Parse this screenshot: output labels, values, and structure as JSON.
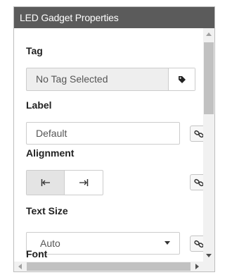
{
  "panel": {
    "title": "LED Gadget Properties"
  },
  "tag": {
    "label": "Tag",
    "value": "No Tag Selected",
    "button_icon": "tag-icon"
  },
  "label_field": {
    "label": "Label",
    "value": "Default",
    "link_icon": "link-icon"
  },
  "alignment": {
    "label": "Alignment",
    "options": [
      {
        "icon": "align-left-icon",
        "glyph": "|←",
        "selected": true
      },
      {
        "icon": "align-right-icon",
        "glyph": "→|",
        "selected": false
      }
    ],
    "link_icon": "link-icon"
  },
  "text_size": {
    "label": "Text Size",
    "value": "Auto",
    "link_icon": "link-icon"
  },
  "font": {
    "label": "Font"
  },
  "colors": {
    "titlebar": "#5b5b5b",
    "scroll_thumb": "#c1c1c1",
    "active_toggle": "#e4e4e4"
  }
}
